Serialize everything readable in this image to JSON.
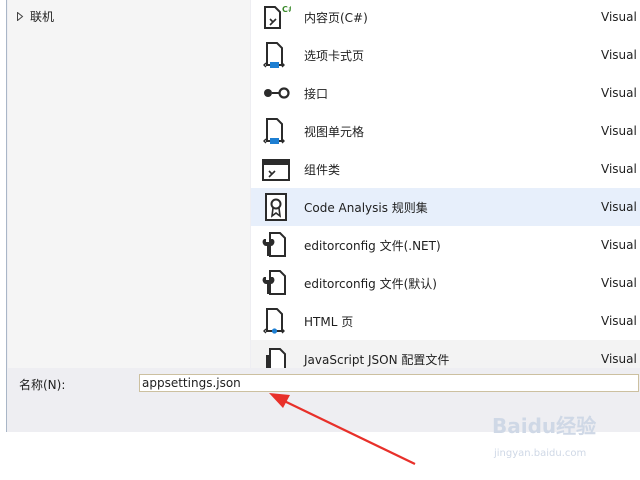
{
  "tree": {
    "items": [
      {
        "label": "联机",
        "arrow_icon": "triangle-right-icon"
      }
    ]
  },
  "template_list": {
    "items": [
      {
        "name": "内容页(C#)",
        "language": "Visual",
        "icon": "content-page-csharp-icon"
      },
      {
        "name": "选项卡式页",
        "language": "Visual",
        "icon": "tabbed-page-icon"
      },
      {
        "name": "接口",
        "language": "Visual",
        "icon": "interface-icon"
      },
      {
        "name": "视图单元格",
        "language": "Visual",
        "icon": "view-cell-icon"
      },
      {
        "name": "组件类",
        "language": "Visual",
        "icon": "component-class-icon"
      },
      {
        "name": "Code Analysis 规则集",
        "language": "Visual",
        "icon": "ruleset-icon",
        "selected": true
      },
      {
        "name": "editorconfig 文件(.NET)",
        "language": "Visual",
        "icon": "editorconfig-icon"
      },
      {
        "name": "editorconfig 文件(默认)",
        "language": "Visual",
        "icon": "editorconfig-icon"
      },
      {
        "name": "HTML 页",
        "language": "Visual",
        "icon": "html-page-icon"
      },
      {
        "name": "JavaScript JSON 配置文件",
        "language": "Visual",
        "icon": "json-config-icon"
      }
    ]
  },
  "name_field": {
    "label": "名称(N):",
    "value": "appsettings.json"
  },
  "watermark": {
    "brand": "Baidu经验",
    "url": "jingyan.baidu.com"
  },
  "colors": {
    "selected_row": "#e7effb",
    "annotation_arrow": "#e8302a",
    "icon_dark": "#2b2b2b",
    "icon_blue": "#1e7fd2",
    "icon_green": "#3a8a2a"
  }
}
